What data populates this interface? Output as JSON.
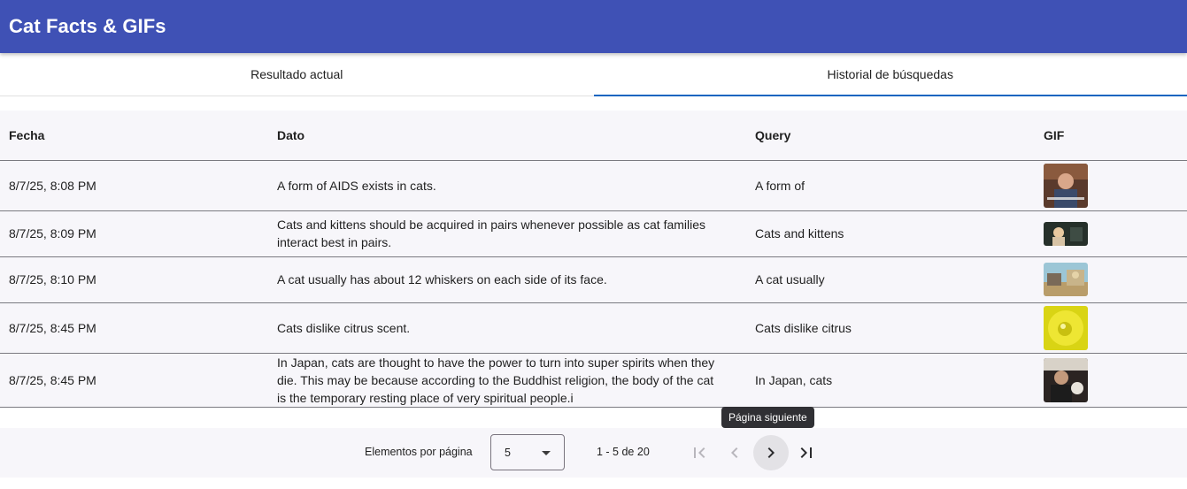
{
  "app": {
    "title": "Cat Facts & GIFs"
  },
  "tabs": [
    {
      "label": "Resultado actual",
      "active": false
    },
    {
      "label": "Historial de búsquedas",
      "active": true
    }
  ],
  "table": {
    "headers": {
      "fecha": "Fecha",
      "dato": "Dato",
      "query": "Query",
      "gif": "GIF"
    },
    "rows": [
      {
        "fecha": "8/7/25, 8:08 PM",
        "dato": "A form of AIDS exists in cats.",
        "query": "A form of",
        "gif_desc": "man-in-room-gif",
        "gif_color": "#6b4a3a"
      },
      {
        "fecha": "8/7/25, 8:09 PM",
        "dato": "Cats and kittens should be acquired in pairs whenever possible as cat families interact best in pairs.",
        "query": "Cats and kittens",
        "gif_desc": "woman-dark-scene-gif",
        "gif_color": "#2f3b33"
      },
      {
        "fecha": "8/7/25, 8:10 PM",
        "dato": "A cat usually has about 12 whiskers on each side of its face.",
        "query": "A cat usually",
        "gif_desc": "cartoon-scene-gif",
        "gif_color": "#8ab7c9"
      },
      {
        "fecha": "8/7/25, 8:45 PM",
        "dato": "Cats dislike citrus scent.",
        "query": "Cats dislike citrus",
        "gif_desc": "lemon-yellow-gif",
        "gif_color": "#e0dc1c"
      },
      {
        "fecha": "8/7/25, 8:45 PM",
        "dato": "In Japan, cats are thought to have the power to turn into super spirits when they die. This may be because according to the Buddhist religion, the body of the cat is the temporary resting place of very spiritual people.i",
        "query": "In Japan, cats",
        "gif_desc": "man-with-cat-gif",
        "gif_color": "#3b3230"
      }
    ]
  },
  "paginator": {
    "items_per_page_label": "Elementos por página",
    "page_size": "5",
    "range_label": "1 - 5 de 20",
    "tooltip": "Página siguiente"
  },
  "colors": {
    "primary": "#3f51b5",
    "tab_indicator": "#1565c0",
    "table_bg": "#f7f6fa"
  }
}
